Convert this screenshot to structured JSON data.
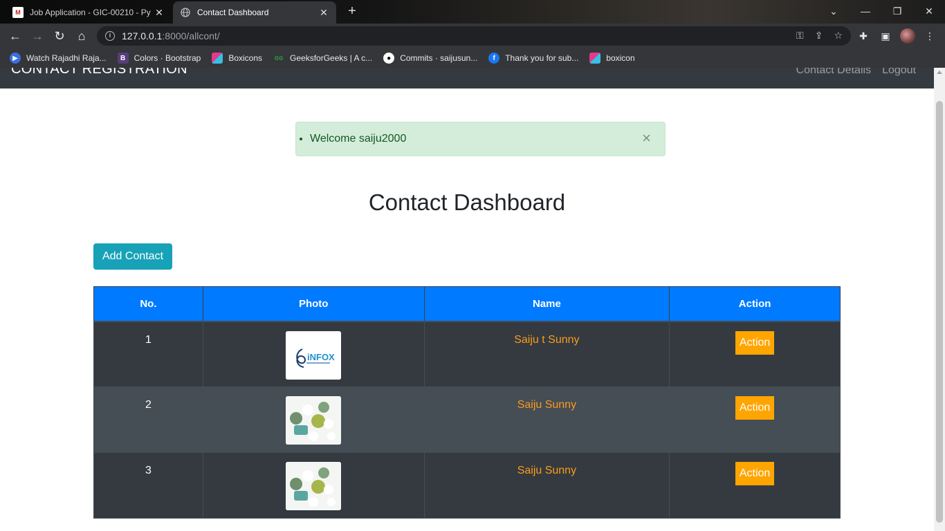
{
  "browser": {
    "tabs": [
      {
        "title": "Job Application - GIC-00210 - Py",
        "active": false,
        "icon": "gmail-icon"
      },
      {
        "title": "Contact Dashboard",
        "active": true,
        "icon": "globe-icon"
      }
    ],
    "url_host": "127.0.0.1",
    "url_rest": ":8000/allcont/",
    "bookmarks": [
      {
        "label": "Watch Rajadhi Raja...",
        "icon": "play-icon",
        "color": "#3b6fe0"
      },
      {
        "label": "Colors · Bootstrap",
        "icon": "bootstrap-icon",
        "color": "#563d7c"
      },
      {
        "label": "Boxicons",
        "icon": "boxicons-icon",
        "color": "#e23a8c"
      },
      {
        "label": "GeeksforGeeks | A c...",
        "icon": "geeksforgeeks-icon",
        "color": "#2f8d46"
      },
      {
        "label": "Commits · saijusun...",
        "icon": "github-icon",
        "color": "#ffffff"
      },
      {
        "label": "Thank you for sub...",
        "icon": "facebook-icon",
        "color": "#1877f2"
      },
      {
        "label": "boxicon",
        "icon": "boxicons-icon",
        "color": "#e23a8c"
      }
    ]
  },
  "navbar": {
    "brand": "CONTACT REGISTRATION",
    "links": [
      "Contact Details",
      "Logout"
    ]
  },
  "alert": {
    "message": "Welcome saiju2000",
    "close": "×"
  },
  "page": {
    "title": "Contact Dashboard",
    "add_button": "Add Contact"
  },
  "table": {
    "headers": [
      "No.",
      "Photo",
      "Name",
      "Action"
    ],
    "rows": [
      {
        "no": "1",
        "photo": "logo",
        "name": "Saiju t Sunny",
        "action": "Action"
      },
      {
        "no": "2",
        "photo": "speech-bubbles",
        "name": "Saiju Sunny",
        "action": "Action"
      },
      {
        "no": "3",
        "photo": "speech-bubbles",
        "name": "Saiju Sunny",
        "action": "Action"
      }
    ]
  },
  "photo_logo_text": "iNFOX",
  "colors": {
    "navbar": "#343a40",
    "table_header": "#007bff",
    "add_button": "#17a2b8",
    "action_button": "#ffa500",
    "name_text": "#fd9c1b",
    "alert_bg": "#d4edda"
  }
}
